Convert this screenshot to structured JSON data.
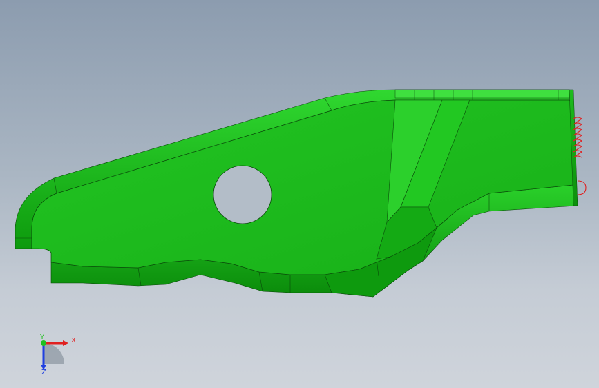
{
  "viewport": {
    "background_top": "#8c9caf",
    "background_bottom": "#cfd4db"
  },
  "part": {
    "face_color": "#1fbf1f",
    "side_color": "#0fa00f",
    "highlight_color": "#3fe03f",
    "edge_color": "#0a4a0a",
    "annotation_color": "#e02020"
  },
  "triad": {
    "x_label": "X",
    "y_label": "Y",
    "z_label": "Z",
    "x_color": "#e02020",
    "y_color": "#20c020",
    "z_color": "#2040e0"
  }
}
